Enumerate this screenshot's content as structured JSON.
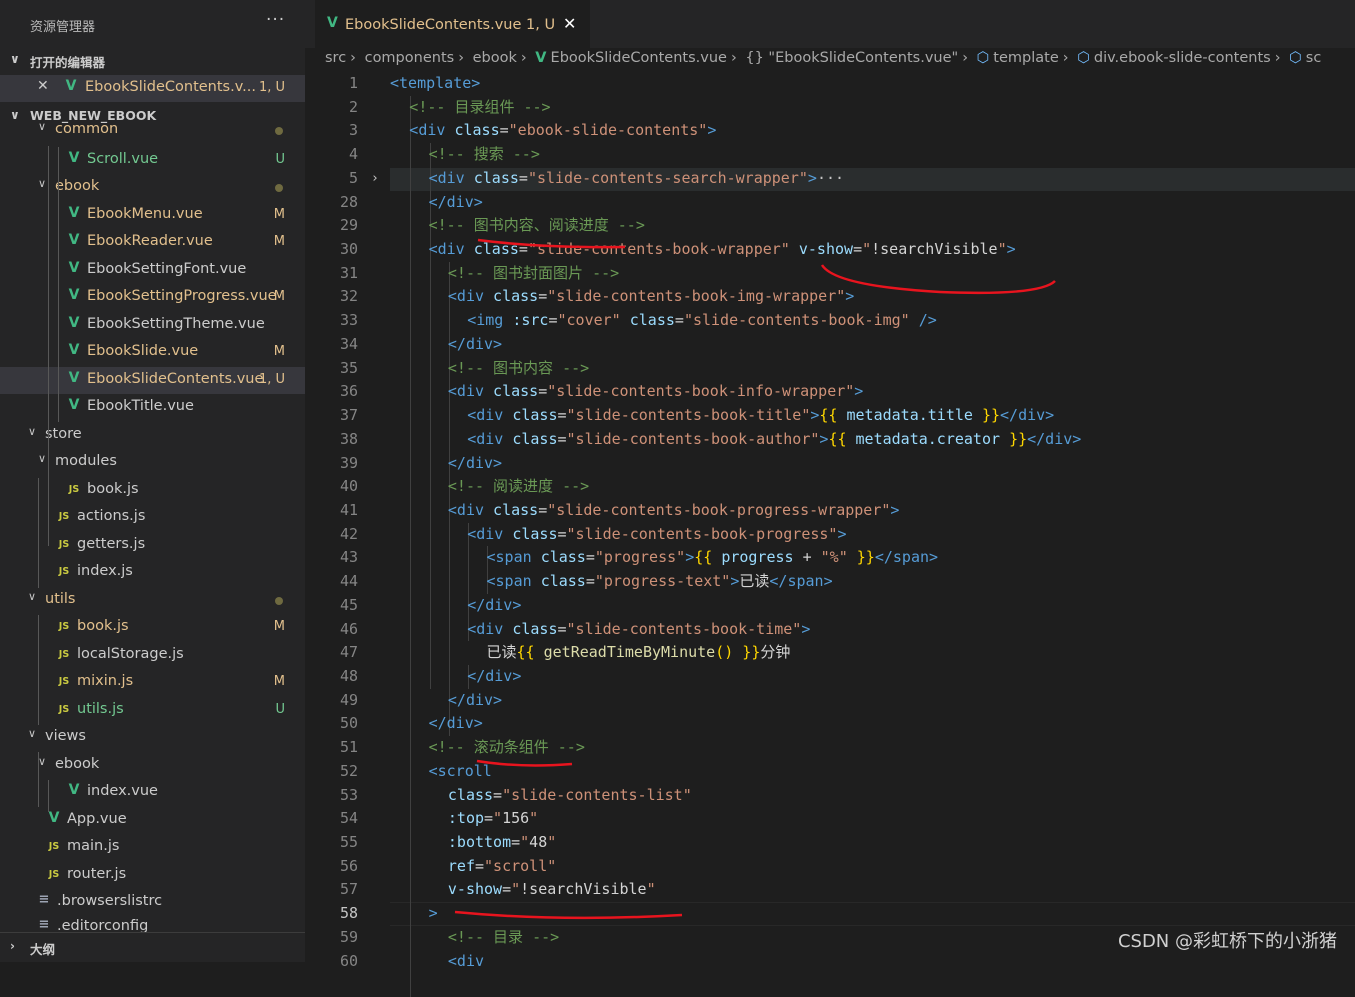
{
  "explorer": {
    "title": "资源管理器",
    "more": "···",
    "open_editors_label": "打开的编辑器",
    "open_editor": {
      "name": "EbookSlideContents.v...",
      "status": "1, U"
    },
    "project_label": "WEB_NEW_EBOOK",
    "outline_label": "大纲",
    "tree": [
      {
        "name": "common",
        "type": "folder",
        "status": "dot"
      },
      {
        "name": "Scroll.vue",
        "type": "vue",
        "status": "U"
      },
      {
        "name": "ebook",
        "type": "folder",
        "status": "dot"
      },
      {
        "name": "EbookMenu.vue",
        "type": "vue",
        "status": "M"
      },
      {
        "name": "EbookReader.vue",
        "type": "vue",
        "status": "M"
      },
      {
        "name": "EbookSettingFont.vue",
        "type": "vue",
        "status": ""
      },
      {
        "name": "EbookSettingProgress.vue",
        "type": "vue",
        "status": "M"
      },
      {
        "name": "EbookSettingTheme.vue",
        "type": "vue",
        "status": ""
      },
      {
        "name": "EbookSlide.vue",
        "type": "vue",
        "status": "M"
      },
      {
        "name": "EbookSlideContents.vue",
        "type": "vue",
        "status": "1, U"
      },
      {
        "name": "EbookTitle.vue",
        "type": "vue",
        "status": ""
      },
      {
        "name": "store",
        "type": "folder",
        "status": ""
      },
      {
        "name": "modules",
        "type": "folder",
        "status": ""
      },
      {
        "name": "book.js",
        "type": "js",
        "status": ""
      },
      {
        "name": "actions.js",
        "type": "js",
        "status": ""
      },
      {
        "name": "getters.js",
        "type": "js",
        "status": ""
      },
      {
        "name": "index.js",
        "type": "js",
        "status": ""
      },
      {
        "name": "utils",
        "type": "folder",
        "status": "dot"
      },
      {
        "name": "book.js",
        "type": "js",
        "status": "M"
      },
      {
        "name": "localStorage.js",
        "type": "js",
        "status": ""
      },
      {
        "name": "mixin.js",
        "type": "js",
        "status": "M"
      },
      {
        "name": "utils.js",
        "type": "js",
        "status": "U"
      },
      {
        "name": "views",
        "type": "folder",
        "status": ""
      },
      {
        "name": "ebook",
        "type": "folder",
        "status": ""
      },
      {
        "name": "index.vue",
        "type": "vue",
        "status": ""
      },
      {
        "name": "App.vue",
        "type": "vue",
        "status": ""
      },
      {
        "name": "main.js",
        "type": "js",
        "status": ""
      },
      {
        "name": "router.js",
        "type": "js",
        "status": ""
      },
      {
        "name": ".browserslistrc",
        "type": "cfg",
        "status": ""
      },
      {
        "name": ".editorconfig",
        "type": "cfg",
        "status": ""
      }
    ]
  },
  "tab": {
    "name": "EbookSlideContents.vue",
    "status": "1, U",
    "close": "✕"
  },
  "breadcrumb": [
    "src",
    "components",
    "ebook",
    "EbookSlideContents.vue",
    "{} \"EbookSlideContents.vue\"",
    "template",
    "div.ebook-slide-contents",
    "sc"
  ],
  "editor": {
    "lines": [
      {
        "n": "1",
        "parts": [
          [
            "t",
            "<template>"
          ]
        ]
      },
      {
        "n": "2",
        "parts": [
          [
            "c",
            "<!-- 目录组件 -->"
          ]
        ]
      },
      {
        "n": "3",
        "parts": [
          [
            "t",
            "<div "
          ],
          [
            "a",
            "class"
          ],
          [
            "x",
            "="
          ],
          [
            "s",
            "\"ebook-slide-contents\""
          ],
          [
            "t",
            ">"
          ]
        ]
      },
      {
        "n": "4",
        "parts": [
          [
            "c",
            "<!-- 搜索 -->"
          ]
        ]
      },
      {
        "n": "5",
        "parts": [
          [
            "t",
            "<div "
          ],
          [
            "a",
            "class"
          ],
          [
            "x",
            "="
          ],
          [
            "s",
            "\"slide-contents-search-wrapper\""
          ],
          [
            "t",
            ">"
          ],
          [
            "e",
            "···"
          ]
        ]
      },
      {
        "n": "28",
        "parts": [
          [
            "t",
            "</div>"
          ]
        ]
      },
      {
        "n": "29",
        "parts": [
          [
            "c",
            "<!-- 图书内容、阅读进度 -->"
          ]
        ]
      },
      {
        "n": "30",
        "parts": [
          [
            "t",
            "<div "
          ],
          [
            "a",
            "class"
          ],
          [
            "x",
            "="
          ],
          [
            "s",
            "\"slide-contents-book-wrapper\""
          ],
          [
            "x",
            " "
          ],
          [
            "a",
            "v-show"
          ],
          [
            "x",
            "="
          ],
          [
            "s",
            "\""
          ],
          [
            "x",
            "!searchVisible"
          ],
          [
            "s",
            "\""
          ],
          [
            "t",
            ">"
          ]
        ]
      },
      {
        "n": "31",
        "parts": [
          [
            "c",
            "<!-- 图书封面图片 -->"
          ]
        ]
      },
      {
        "n": "32",
        "parts": [
          [
            "t",
            "<div "
          ],
          [
            "a",
            "class"
          ],
          [
            "x",
            "="
          ],
          [
            "s",
            "\"slide-contents-book-img-wrapper\""
          ],
          [
            "t",
            ">"
          ]
        ]
      },
      {
        "n": "33",
        "parts": [
          [
            "t",
            "<img "
          ],
          [
            "a",
            ":src"
          ],
          [
            "x",
            "="
          ],
          [
            "s",
            "\"cover\""
          ],
          [
            "x",
            " "
          ],
          [
            "a",
            "class"
          ],
          [
            "x",
            "="
          ],
          [
            "s",
            "\"slide-contents-book-img\""
          ],
          [
            "x",
            " "
          ],
          [
            "t",
            "/>"
          ]
        ]
      },
      {
        "n": "34",
        "parts": [
          [
            "t",
            "</div>"
          ]
        ]
      },
      {
        "n": "35",
        "parts": [
          [
            "c",
            "<!-- 图书内容 -->"
          ]
        ]
      },
      {
        "n": "36",
        "parts": [
          [
            "t",
            "<div "
          ],
          [
            "a",
            "class"
          ],
          [
            "x",
            "="
          ],
          [
            "s",
            "\"slide-contents-book-info-wrapper\""
          ],
          [
            "t",
            ">"
          ]
        ]
      },
      {
        "n": "37",
        "parts": [
          [
            "t",
            "<div "
          ],
          [
            "a",
            "class"
          ],
          [
            "x",
            "="
          ],
          [
            "s",
            "\"slide-contents-book-title\""
          ],
          [
            "t",
            ">"
          ],
          [
            "b",
            "{{"
          ],
          [
            "x",
            " "
          ],
          [
            "a",
            "metadata.title"
          ],
          [
            "x",
            " "
          ],
          [
            "b",
            "}}"
          ],
          [
            "t",
            "</div>"
          ]
        ]
      },
      {
        "n": "38",
        "parts": [
          [
            "t",
            "<div "
          ],
          [
            "a",
            "class"
          ],
          [
            "x",
            "="
          ],
          [
            "s",
            "\"slide-contents-book-author\""
          ],
          [
            "t",
            ">"
          ],
          [
            "b",
            "{{"
          ],
          [
            "x",
            " "
          ],
          [
            "a",
            "metadata.creator"
          ],
          [
            "x",
            " "
          ],
          [
            "b",
            "}}"
          ],
          [
            "t",
            "</div>"
          ]
        ]
      },
      {
        "n": "39",
        "parts": [
          [
            "t",
            "</div>"
          ]
        ]
      },
      {
        "n": "40",
        "parts": [
          [
            "c",
            "<!-- 阅读进度 -->"
          ]
        ]
      },
      {
        "n": "41",
        "parts": [
          [
            "t",
            "<div "
          ],
          [
            "a",
            "class"
          ],
          [
            "x",
            "="
          ],
          [
            "s",
            "\"slide-contents-book-progress-wrapper\""
          ],
          [
            "t",
            ">"
          ]
        ]
      },
      {
        "n": "42",
        "parts": [
          [
            "t",
            "<div "
          ],
          [
            "a",
            "class"
          ],
          [
            "x",
            "="
          ],
          [
            "s",
            "\"slide-contents-book-progress\""
          ],
          [
            "t",
            ">"
          ]
        ]
      },
      {
        "n": "43",
        "parts": [
          [
            "t",
            "<span "
          ],
          [
            "a",
            "class"
          ],
          [
            "x",
            "="
          ],
          [
            "s",
            "\"progress\""
          ],
          [
            "t",
            ">"
          ],
          [
            "b",
            "{{"
          ],
          [
            "x",
            " "
          ],
          [
            "a",
            "progress"
          ],
          [
            "x",
            " + "
          ],
          [
            "s",
            "\"%\""
          ],
          [
            "x",
            " "
          ],
          [
            "b",
            "}}"
          ],
          [
            "t",
            "</span>"
          ]
        ]
      },
      {
        "n": "44",
        "parts": [
          [
            "t",
            "<span "
          ],
          [
            "a",
            "class"
          ],
          [
            "x",
            "="
          ],
          [
            "s",
            "\"progress-text\""
          ],
          [
            "t",
            ">"
          ],
          [
            "x",
            "已读"
          ],
          [
            "t",
            "</span>"
          ]
        ]
      },
      {
        "n": "45",
        "parts": [
          [
            "t",
            "</div>"
          ]
        ]
      },
      {
        "n": "46",
        "parts": [
          [
            "t",
            "<div "
          ],
          [
            "a",
            "class"
          ],
          [
            "x",
            "="
          ],
          [
            "s",
            "\"slide-contents-book-time\""
          ],
          [
            "t",
            ">"
          ]
        ]
      },
      {
        "n": "47",
        "parts": [
          [
            "x",
            "已读"
          ],
          [
            "b",
            "{{"
          ],
          [
            "x",
            " "
          ],
          [
            "f",
            "getReadTimeByMinute"
          ],
          [
            "b",
            "()"
          ],
          [
            "x",
            " "
          ],
          [
            "b",
            "}}"
          ],
          [
            "x",
            "分钟"
          ]
        ]
      },
      {
        "n": "48",
        "parts": [
          [
            "t",
            "</div>"
          ]
        ]
      },
      {
        "n": "49",
        "parts": [
          [
            "t",
            "</div>"
          ]
        ]
      },
      {
        "n": "50",
        "parts": [
          [
            "t",
            "</div>"
          ]
        ]
      },
      {
        "n": "51",
        "parts": [
          [
            "c",
            "<!-- 滚动条组件 -->"
          ]
        ]
      },
      {
        "n": "52",
        "parts": [
          [
            "t",
            "<scroll"
          ]
        ]
      },
      {
        "n": "53",
        "parts": [
          [
            "a",
            "class"
          ],
          [
            "x",
            "="
          ],
          [
            "s",
            "\"slide-contents-list\""
          ]
        ]
      },
      {
        "n": "54",
        "parts": [
          [
            "a",
            ":top"
          ],
          [
            "x",
            "="
          ],
          [
            "s",
            "\""
          ],
          [
            "x",
            "156"
          ],
          [
            "s",
            "\""
          ]
        ]
      },
      {
        "n": "55",
        "parts": [
          [
            "a",
            ":bottom"
          ],
          [
            "x",
            "="
          ],
          [
            "s",
            "\""
          ],
          [
            "x",
            "48"
          ],
          [
            "s",
            "\""
          ]
        ]
      },
      {
        "n": "56",
        "parts": [
          [
            "a",
            "ref"
          ],
          [
            "x",
            "="
          ],
          [
            "s",
            "\"scroll\""
          ]
        ]
      },
      {
        "n": "57",
        "parts": [
          [
            "a",
            "v-show"
          ],
          [
            "x",
            "="
          ],
          [
            "s",
            "\""
          ],
          [
            "x",
            "!searchVisible"
          ],
          [
            "s",
            "\""
          ]
        ]
      },
      {
        "n": "58",
        "parts": [
          [
            "t",
            ">"
          ]
        ]
      },
      {
        "n": "59",
        "parts": [
          [
            "c",
            "<!-- 目录 -->"
          ]
        ]
      },
      {
        "n": "60",
        "parts": [
          [
            "t",
            "<div"
          ]
        ]
      }
    ]
  },
  "watermark": "CSDN @彩虹桥下的小浙猪",
  "colors": {
    "vue_icon": "#41b883",
    "js_icon": "#cbcb41",
    "modified": "#e2c08d",
    "untracked": "#73c991",
    "annotation": "#e8141e"
  }
}
